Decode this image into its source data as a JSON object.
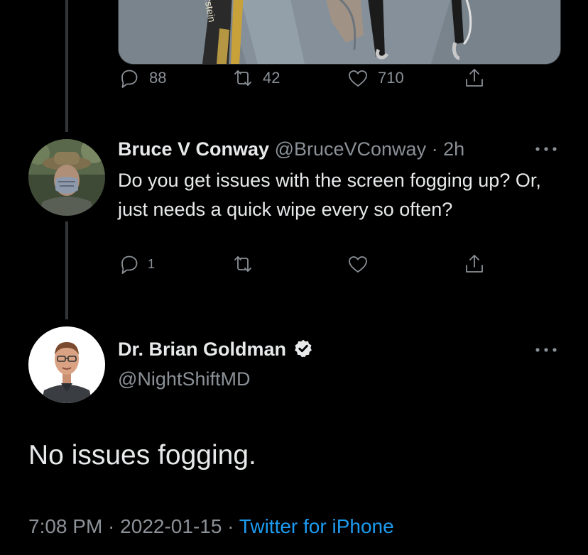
{
  "parent_tweet": {
    "media_text": "rstein",
    "actions": {
      "replies": "88",
      "retweets": "42",
      "likes": "710"
    }
  },
  "reply_tweet": {
    "name": "Bruce V Conway",
    "handle": "@BruceVConway",
    "separator": " · ",
    "time": "2h",
    "text": "Do you get issues with the screen fogging up? Or, just needs a quick wipe every so often?",
    "actions": {
      "replies": "1",
      "retweets": "",
      "likes": ""
    }
  },
  "main_tweet": {
    "name": "Dr. Brian Goldman",
    "handle": "@NightShiftMD",
    "text": "No issues fogging.",
    "time": "7:08 PM",
    "separator": " · ",
    "date": "2022-01-15",
    "source": "Twitter for iPhone"
  },
  "colors": {
    "background": "#000000",
    "primary_text": "#e7e9ea",
    "secondary_text": "#71767b",
    "link": "#1d9bf0",
    "verified_badge": "#e7e9ea"
  },
  "icons": {
    "reply": "reply-icon",
    "retweet": "retweet-icon",
    "like": "heart-icon",
    "share": "share-icon",
    "more": "more-icon",
    "verified": "verified-badge-icon"
  }
}
